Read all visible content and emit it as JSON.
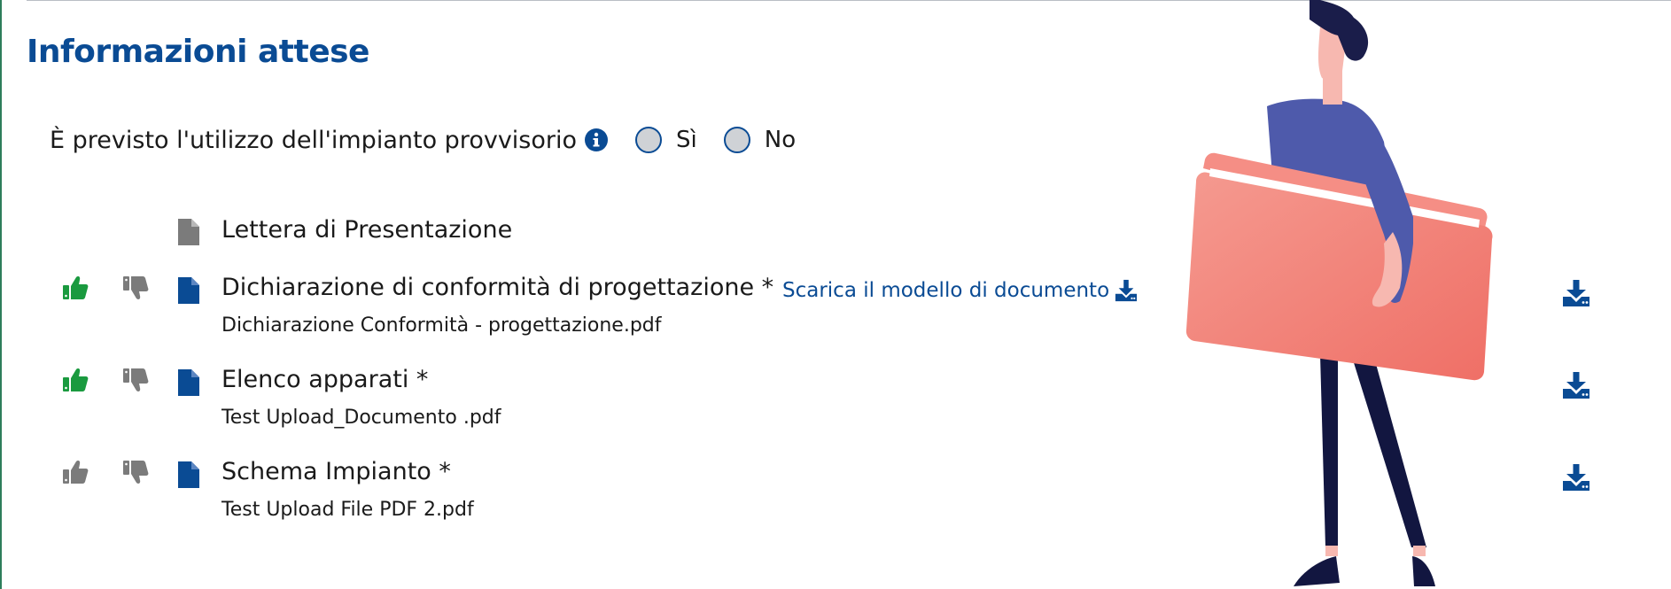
{
  "section": {
    "title": "Informazioni attese"
  },
  "question": {
    "text": "È previsto l'utilizzo dell'impianto provvisorio",
    "options": [
      {
        "label": "Sì"
      },
      {
        "label": "No"
      }
    ]
  },
  "documents": [
    {
      "name": "Lettera di Presentazione",
      "file": "",
      "approved": null
    },
    {
      "name": "Dichiarazione di conformità di progettazione *",
      "file": "Dichiarazione Conformità - progettazione.pdf",
      "approved": true,
      "template_link": "Scarica il modello di documento"
    },
    {
      "name": "Elenco apparati *",
      "file": "Test Upload_Documento .pdf",
      "approved": true
    },
    {
      "name": "Schema Impianto *",
      "file": "Test Upload File PDF 2.pdf",
      "approved": false
    }
  ],
  "colors": {
    "brand_blue": "#0a4b94",
    "approve_green": "#1a9a3f",
    "neutral_gray": "#7b7b7b",
    "folder_pink": "#f07c74"
  },
  "icons": {
    "info": "info-icon",
    "thumbs_up": "thumbs-up-icon",
    "thumbs_down": "thumbs-down-icon",
    "file": "file-icon",
    "download": "download-icon"
  }
}
